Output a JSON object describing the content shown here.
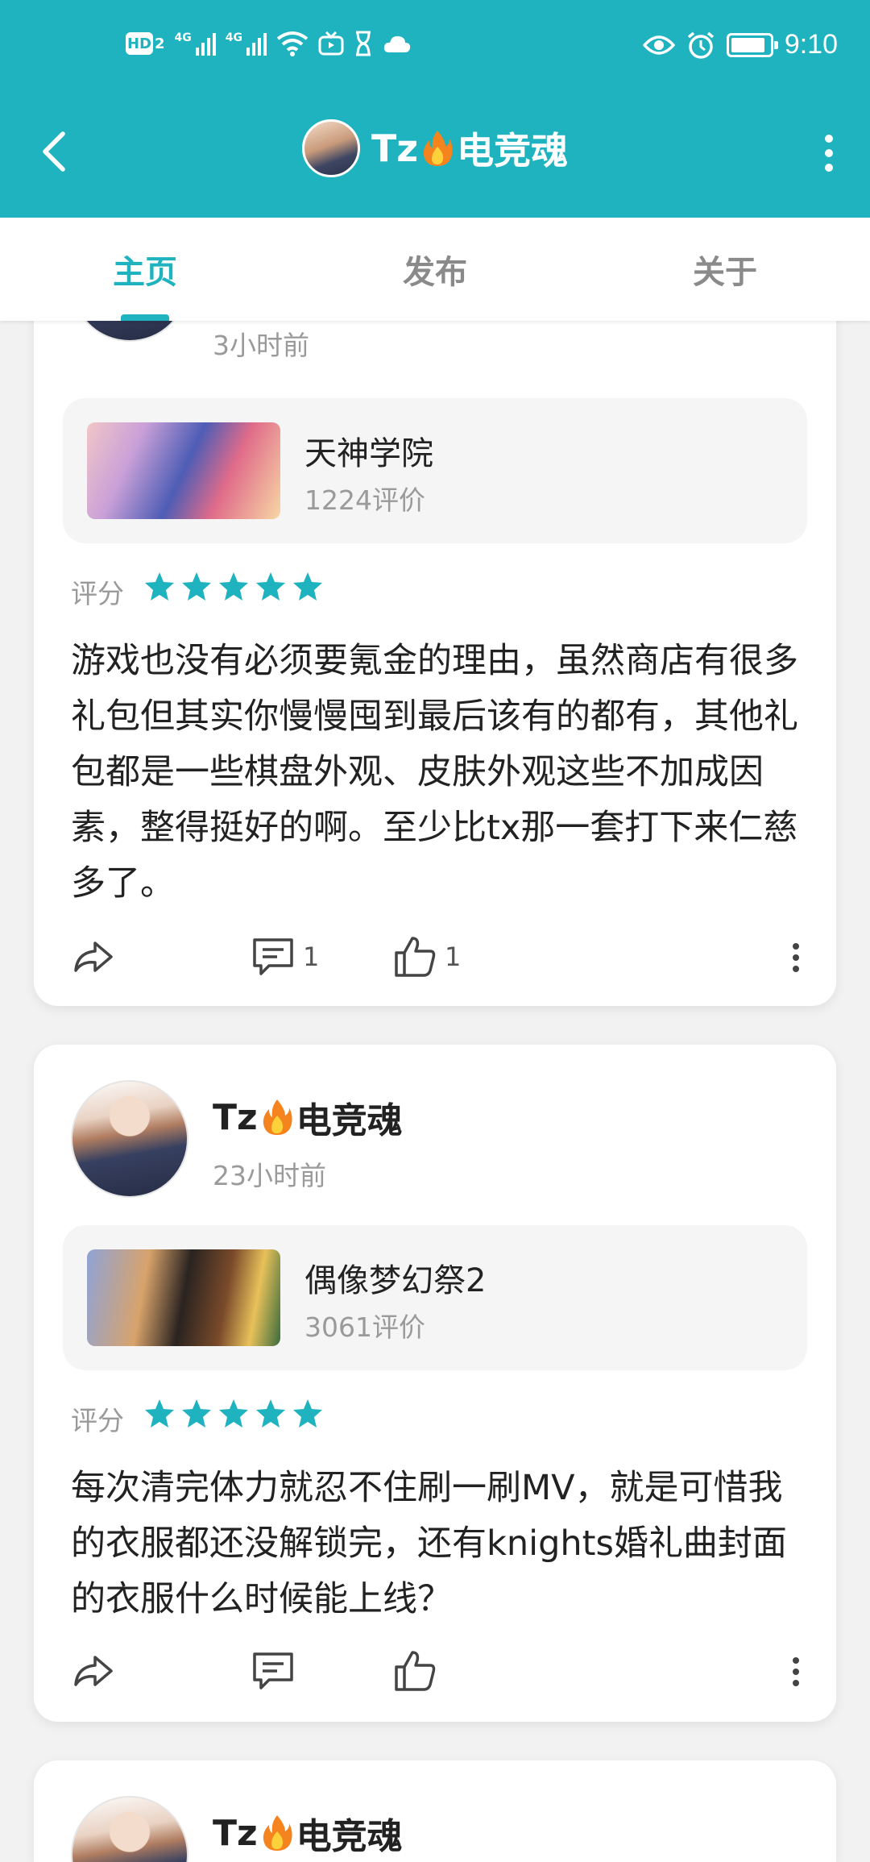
{
  "status_bar": {
    "hd_label": "HD",
    "hd_sub": "2",
    "net1": "4G",
    "net2": "4G",
    "time": "9:10"
  },
  "app_bar": {
    "title": "Tz",
    "title_suffix": "电竞魂"
  },
  "tabs": [
    {
      "label": "主页",
      "active": true
    },
    {
      "label": "发布",
      "active": false
    },
    {
      "label": "关于",
      "active": false
    }
  ],
  "posts": [
    {
      "time_ago": "3小时前",
      "game": {
        "name": "天神学院",
        "reviews": "1224评价"
      },
      "rating_label": "评分",
      "stars": 5,
      "text": "游戏也没有必须要氪金的理由，虽然商店有很多礼包但其实你慢慢囤到最后该有的都有，其他礼包都是一些棋盘外观、皮肤外观这些不加成因素，整得挺好的啊。至少比tx那一套打下来仁慈多了。",
      "comments": "1",
      "likes": "1"
    },
    {
      "author": "Tz",
      "author_suffix": "电竞魂",
      "time_ago": "23小时前",
      "game": {
        "name": "偶像梦幻祭2",
        "reviews": "3061评价"
      },
      "rating_label": "评分",
      "stars": 5,
      "text": "每次清完体力就忍不住刷一刷MV，就是可惜我的衣服都还没解锁完，还有knights婚礼曲封面的衣服什么时候能上线？",
      "comments": "",
      "likes": ""
    },
    {
      "author": "Tz",
      "author_suffix": "电竞魂"
    }
  ],
  "colors": {
    "accent": "#1eb3bf",
    "star": "#1eb3bf",
    "background": "#f2f2f2"
  }
}
